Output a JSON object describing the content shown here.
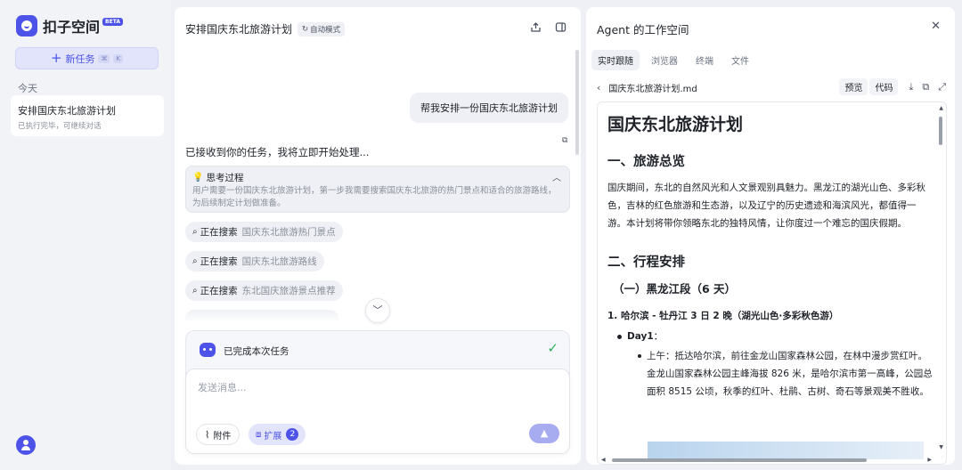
{
  "app": {
    "name": "扣子空间",
    "beta": "BETA"
  },
  "sidebar": {
    "new_task_label": "新任务",
    "new_task_shortcut_1": "⌘",
    "new_task_shortcut_2": "K",
    "section_today": "今天",
    "tasks": [
      {
        "title": "安排国庆东北旅游计划",
        "status": "已执行完毕，可继续对话"
      }
    ]
  },
  "chat": {
    "title": "安排国庆东北旅游计划",
    "mode_badge": "自动模式",
    "user_message": "帮我安排一份国庆东北旅游计划",
    "agent_reply": "已接收到你的任务，我将立即开始处理...",
    "thinking": {
      "title": "思考过程",
      "body": "用户需要一份国庆东北旅游计划，第一步我需要搜索国庆东北旅游的热门景点和适合的旅游路线，为后续制定计划做准备。"
    },
    "searches": [
      {
        "label": "正在搜索",
        "query": "国庆东北旅游热门景点"
      },
      {
        "label": "正在搜索",
        "query": "国庆东北旅游路线"
      },
      {
        "label": "正在搜索",
        "query": "东北国庆旅游景点推荐"
      }
    ],
    "done_text": "已完成本次任务",
    "composer": {
      "placeholder": "发送消息...",
      "attach_label": "附件",
      "extend_label": "扩展",
      "extend_count": "2"
    }
  },
  "workspace": {
    "title": "Agent 的工作空间",
    "tabs": [
      "实时跟随",
      "浏览器",
      "终端",
      "文件"
    ],
    "active_tab": 0,
    "file_name": "国庆东北旅游计划.md",
    "preview_label": "预览",
    "code_label": "代码",
    "doc": {
      "h1": "国庆东北旅游计划",
      "overview_heading": "一、旅游总览",
      "overview_text": "国庆期间，东北的自然风光和人文景观别具魅力。黑龙江的湖光山色、多彩秋色，吉林的红色旅游和生态游，以及辽宁的历史遗迹和海滨风光，都值得一游。本计划将带你领略东北的独特风情，让你度过一个难忘的国庆假期。",
      "itinerary_heading": "二、行程安排",
      "section_heading": "（一）黑龙江段（6 天）",
      "route_heading": "1. 哈尔滨 - 牡丹江 3 日 2 晚（湖光山色·多彩秋色游）",
      "day_label": "Day1",
      "day_colon": "：",
      "day_item": "上午：抵达哈尔滨，前往金龙山国家森林公园，在林中漫步赏红叶。金龙山国家森林公园主峰海拔 826 米，是哈尔滨市第一高峰，公园总面积 8515 公顷，秋季的红叶、杜鹃、古树、奇石等景观美不胜收。"
    }
  },
  "colors": {
    "accent": "#4d53e8",
    "success": "#2fae5c"
  },
  "icons": [
    "robot-logo-icon",
    "plus-icon",
    "user-icon",
    "share-icon",
    "split-view-icon",
    "copy-icon",
    "bulb-icon",
    "chevron-up-icon",
    "search-icon",
    "chevron-down-icon",
    "bot-icon",
    "check-icon",
    "paperclip-icon",
    "extension-icon",
    "send-icon",
    "close-icon",
    "back-icon",
    "download-icon",
    "duplicate-icon",
    "expand-icon"
  ]
}
